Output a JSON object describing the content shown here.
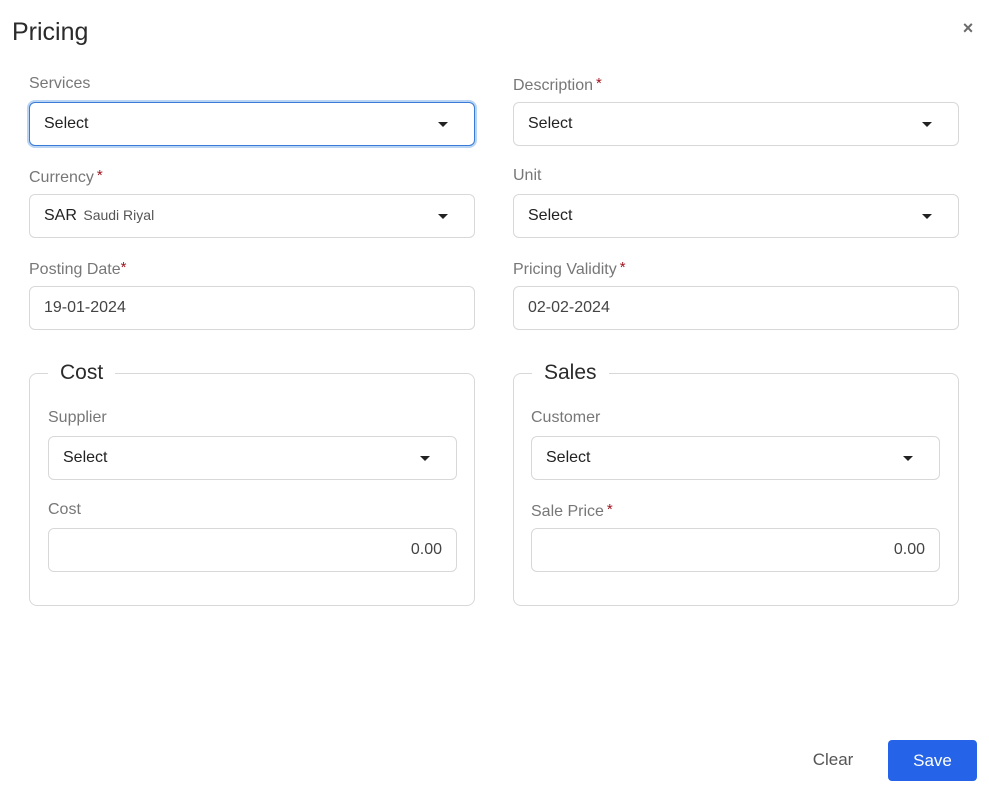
{
  "dialog": {
    "title": "Pricing",
    "close_icon": "close-icon"
  },
  "fields": {
    "services": {
      "label": "Services",
      "required": false,
      "value": "Select"
    },
    "description": {
      "label": "Description",
      "required": true,
      "value": "Select"
    },
    "currency": {
      "label": "Currency",
      "required": true,
      "code": "SAR",
      "name": "Saudi Riyal"
    },
    "unit": {
      "label": "Unit",
      "required": false,
      "value": "Select"
    },
    "posting_date": {
      "label": "Posting Date",
      "required": true,
      "value": "19-01-2024"
    },
    "pricing_validity": {
      "label": "Pricing Validity",
      "required": true,
      "value": "02-02-2024"
    }
  },
  "cost_group": {
    "title": "Cost",
    "supplier": {
      "label": "Supplier",
      "value": "Select"
    },
    "cost": {
      "label": "Cost",
      "value": "0.00"
    }
  },
  "sales_group": {
    "title": "Sales",
    "customer": {
      "label": "Customer",
      "value": "Select"
    },
    "sale_price": {
      "label": "Sale Price",
      "required": true,
      "value": "0.00"
    }
  },
  "required_marker": "*",
  "footer": {
    "clear_label": "Clear",
    "save_label": "Save"
  },
  "colors": {
    "primary": "#2563e8",
    "required": "#a0141e",
    "focus_border": "#3a7bd5"
  }
}
